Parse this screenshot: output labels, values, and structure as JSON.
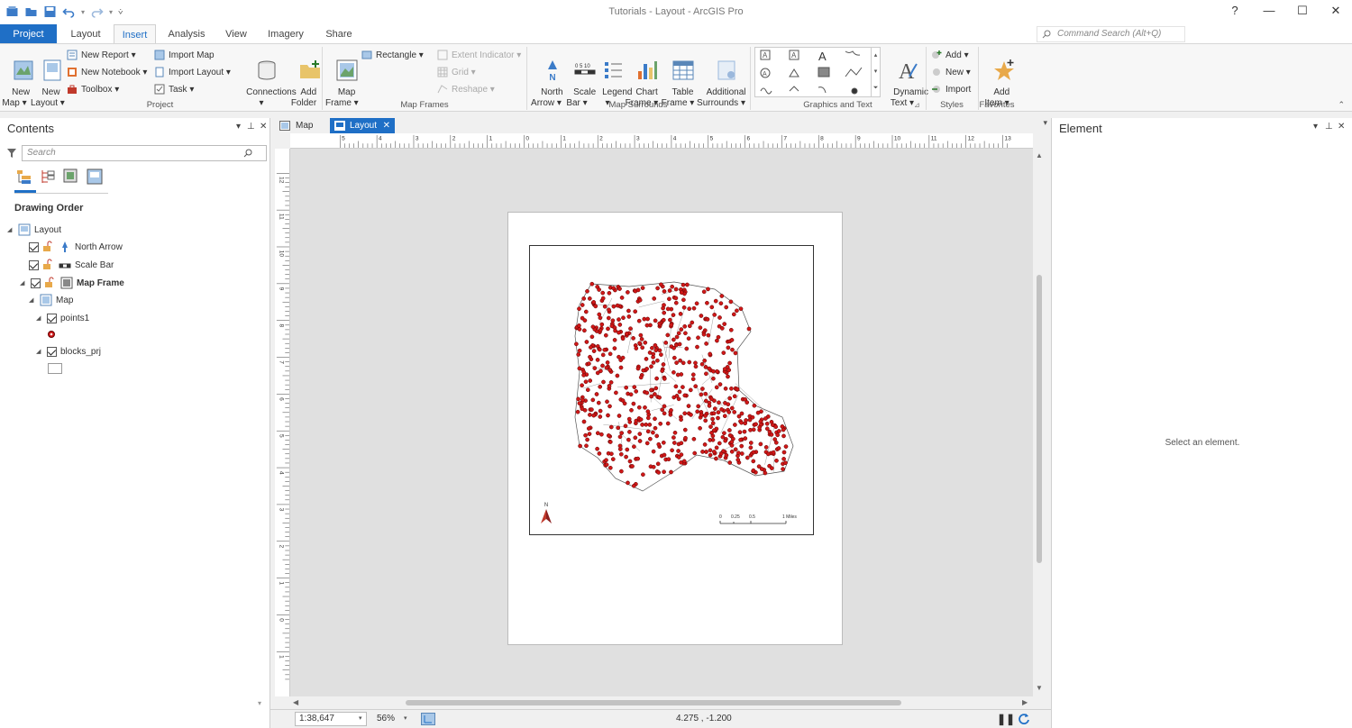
{
  "window": {
    "title": "Tutorials - Layout - ArcGIS Pro"
  },
  "titlebar_controls": {
    "help": "?",
    "minimize": "—",
    "maximize": "☐",
    "close": "✕"
  },
  "tabs": [
    {
      "label": "Project"
    },
    {
      "label": "Layout"
    },
    {
      "label": "Insert"
    },
    {
      "label": "Analysis"
    },
    {
      "label": "View"
    },
    {
      "label": "Imagery"
    },
    {
      "label": "Share"
    }
  ],
  "command_search": {
    "placeholder": "Command Search (Alt+Q)"
  },
  "ribbon": {
    "project": {
      "new_map": "New\nMap ▾",
      "new_layout": "New\nLayout ▾",
      "new_report": "New Report ▾",
      "new_notebook": "New Notebook ▾",
      "toolbox": "Toolbox ▾",
      "import_map": "Import Map",
      "import_layout": "Import Layout ▾",
      "task": "Task ▾",
      "connections": "Connections\n▾",
      "add_folder": "Add\nFolder",
      "group": "Project"
    },
    "map_frames": {
      "map_frame": "Map\nFrame ▾",
      "rectangle": "Rectangle ▾",
      "extent_indicator": "Extent Indicator ▾",
      "grid": "Grid ▾",
      "reshape": "Reshape ▾",
      "group": "Map Frames"
    },
    "map_surrounds": {
      "north_arrow": "North\nArrow ▾",
      "scale_bar": "Scale\nBar ▾",
      "legend": "Legend\n▾",
      "chart_frame": "Chart\nFrame ▾",
      "table_frame": "Table\nFrame ▾",
      "additional_surrounds": "Additional\nSurrounds ▾",
      "group": "Map Surrounds"
    },
    "graphics_text": {
      "dynamic_text": "Dynamic\nText ▾",
      "group": "Graphics and Text"
    },
    "styles": {
      "add": "Add ▾",
      "new": "New ▾",
      "import": "Import",
      "group": "Styles"
    },
    "favorites": {
      "add_item": "Add\nItem ▾",
      "group": "Favorites"
    }
  },
  "contents": {
    "title": "Contents",
    "search_placeholder": "Search",
    "section": "Drawing Order",
    "items": [
      {
        "label": "Layout"
      },
      {
        "label": "North Arrow"
      },
      {
        "label": "Scale Bar"
      },
      {
        "label": "Map Frame"
      },
      {
        "label": "Map"
      },
      {
        "label": "points1"
      },
      {
        "label": "blocks_prj"
      }
    ]
  },
  "view_tabs": [
    {
      "label": "Map"
    },
    {
      "label": "Layout"
    }
  ],
  "ruler": {
    "top_labels": [
      "5",
      "4",
      "3",
      "2",
      "1",
      "0",
      "1",
      "2",
      "3",
      "4",
      "5",
      "6",
      "7",
      "8",
      "9",
      "10",
      "11",
      "12",
      "13"
    ],
    "left_labels": [
      "12",
      "11",
      "10",
      "9",
      "8",
      "7",
      "6",
      "5",
      "4",
      "3",
      "2",
      "1",
      "0",
      "1"
    ]
  },
  "map": {
    "north_label": "N",
    "scalebar_labels": [
      "0",
      "0.25",
      "0.5",
      "1 Miles"
    ],
    "point_color": "#d01818"
  },
  "element_pane": {
    "title": "Element",
    "message": "Select an element."
  },
  "statusbar": {
    "scale": "1:38,647",
    "zoom": "56%",
    "coords": "4.275 , -1.200"
  },
  "colors": {
    "accent": "#1f6fc6",
    "point": "#d01818"
  }
}
